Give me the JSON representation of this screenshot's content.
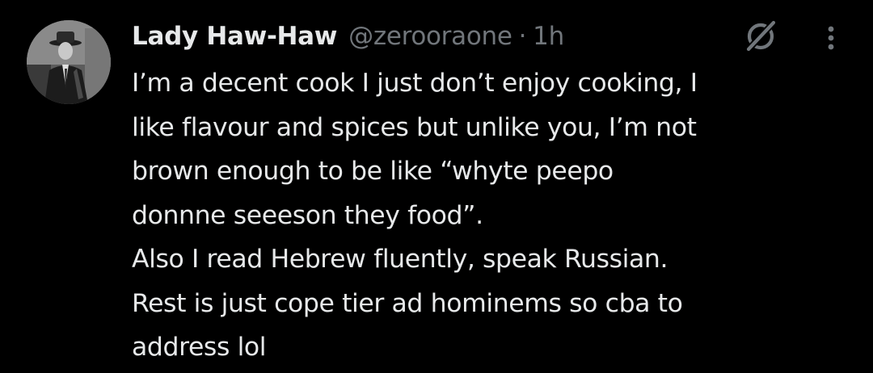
{
  "tweet": {
    "author": {
      "display_name": "Lady Haw-Haw",
      "handle": "@zerooraone",
      "avatar_icon": "profile-photo"
    },
    "separator": "·",
    "time": "1h",
    "icons": {
      "grok": "grok-icon",
      "more": "more-options-icon"
    },
    "body_lines": [
      "I’m a decent cook I just don’t enjoy cooking, I",
      "like flavour and spices but unlike you, I’m not",
      "brown enough to be like “whyte peepo",
      "donnne seeeson they food”.",
      "Also I read Hebrew fluently, speak Russian.",
      "Rest is just cope tier ad hominems so cba to",
      "address lol"
    ]
  },
  "colors": {
    "background": "#000000",
    "primary_text": "#e7e9ea",
    "secondary_text": "#71767b"
  }
}
